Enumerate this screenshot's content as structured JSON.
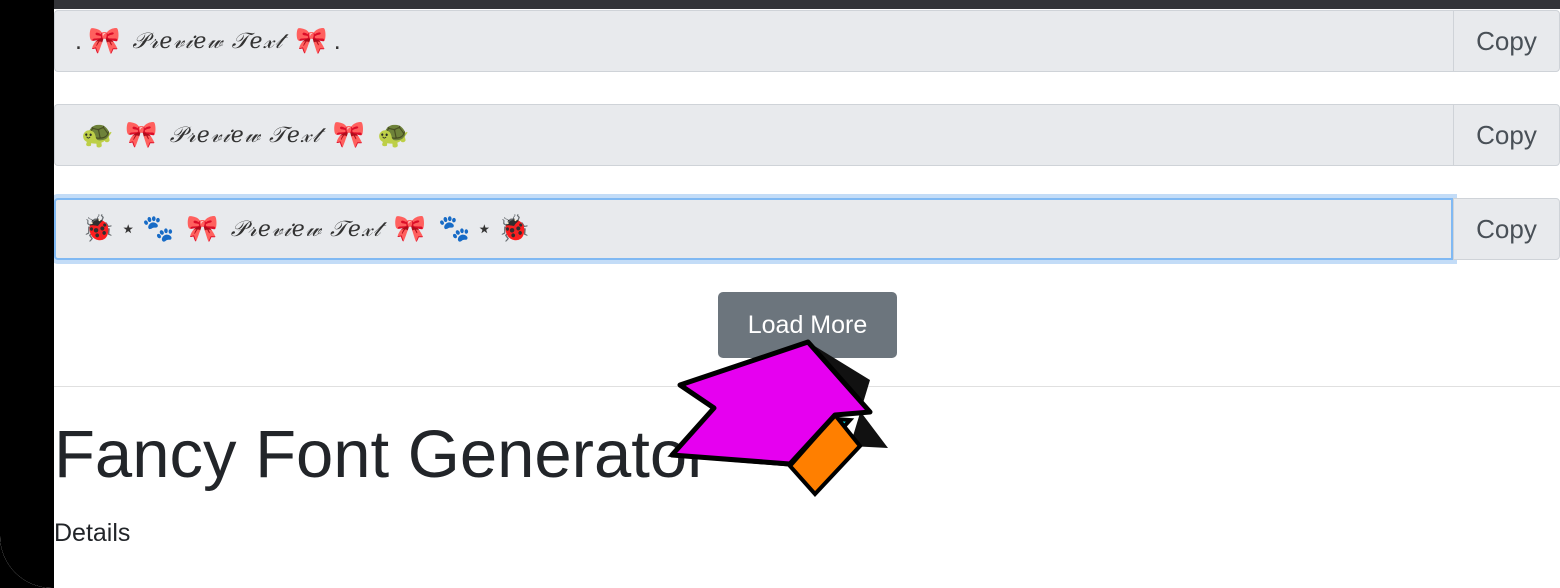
{
  "rows": [
    {
      "prefix": ".",
      "suffix": ".",
      "preview": "𝒫𝓇𝑒𝓋𝒾𝑒𝓌 𝒯𝑒𝓍𝓉",
      "copy_label": "Copy",
      "focused": false
    },
    {
      "preview": "𝒫𝓇𝑒𝓋𝒾𝑒𝓌 𝒯𝑒𝓍𝓉",
      "copy_label": "Copy",
      "focused": false
    },
    {
      "preview": "𝒫𝓇𝑒𝓋𝒾𝑒𝓌 𝒯𝑒𝓍𝓉",
      "star": "⋆",
      "copy_label": "Copy",
      "focused": true
    }
  ],
  "load_more_label": "Load More",
  "page_title": "Fancy Font Generator",
  "details_label": "Details",
  "icons": {
    "bow": "🎀",
    "turtle": "🐢",
    "ladybug": "🐞",
    "paws": "🐾",
    "cursor": "3d-arrow-cursor-icon"
  },
  "colors": {
    "button": "#6c757d",
    "focus": "#80b9f3",
    "field": "#e8eaed",
    "arrow_face": "#e600f0",
    "arrow_side": "#ff7f00",
    "arrow_bottom": "#00e5f5"
  }
}
